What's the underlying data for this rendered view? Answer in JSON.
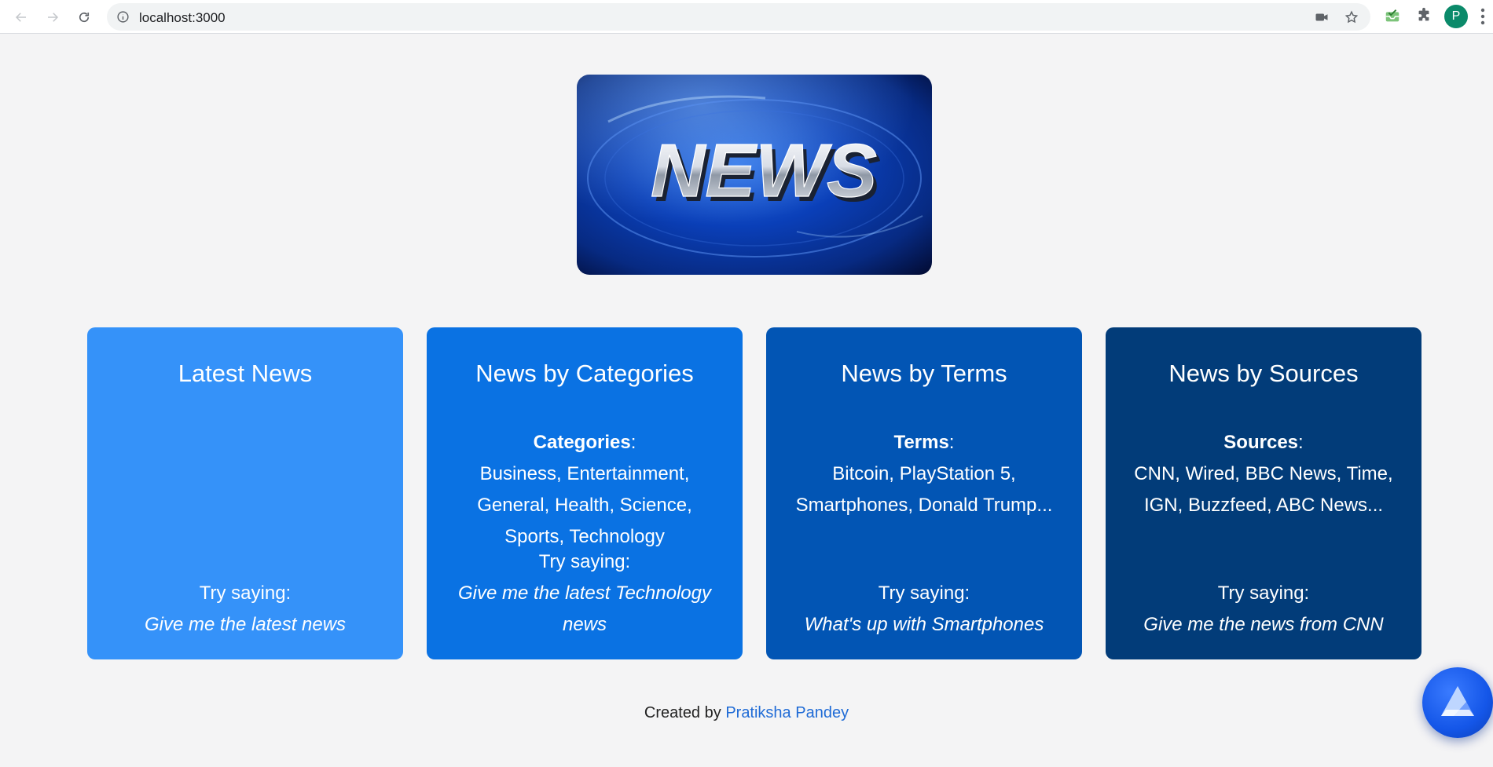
{
  "browser": {
    "url": "localhost:3000",
    "profile_initial": "P"
  },
  "hero": {
    "logo_text": "NEWS"
  },
  "cards": [
    {
      "title": "Latest News",
      "heading": "",
      "items": "",
      "try_label": "Try saying:",
      "example": "Give me the latest news",
      "color": "#3592f9"
    },
    {
      "title": "News by Categories",
      "heading": "Categories",
      "items": "Business, Entertainment, General, Health, Science, Sports, Technology",
      "try_label": "Try saying:",
      "example": "Give me the latest Technology news",
      "color": "#0a72e3"
    },
    {
      "title": "News by Terms",
      "heading": "Terms",
      "items": "Bitcoin, PlayStation 5, Smartphones, Donald Trump...",
      "try_label": "Try saying:",
      "example": "What's up with Smartphones",
      "color": "#0255b4"
    },
    {
      "title": "News by Sources",
      "heading": "Sources",
      "items": "CNN, Wired, BBC News, Time, IGN, Buzzfeed, ABC News...",
      "try_label": "Try saying:",
      "example": "Give me the news from CNN",
      "color": "#023c79"
    }
  ],
  "footer": {
    "prefix": "Created by",
    "author": "Pratiksha Pandey"
  },
  "icons": {
    "back": "arrow-left-icon",
    "forward": "arrow-right-icon",
    "reload": "reload-icon",
    "info": "info-icon",
    "camera": "camera-icon",
    "star": "star-icon",
    "extension1": "inbox-extension-icon",
    "extension2": "puzzle-icon",
    "menu": "more-vert-icon",
    "assistant": "alan-assistant-icon"
  }
}
